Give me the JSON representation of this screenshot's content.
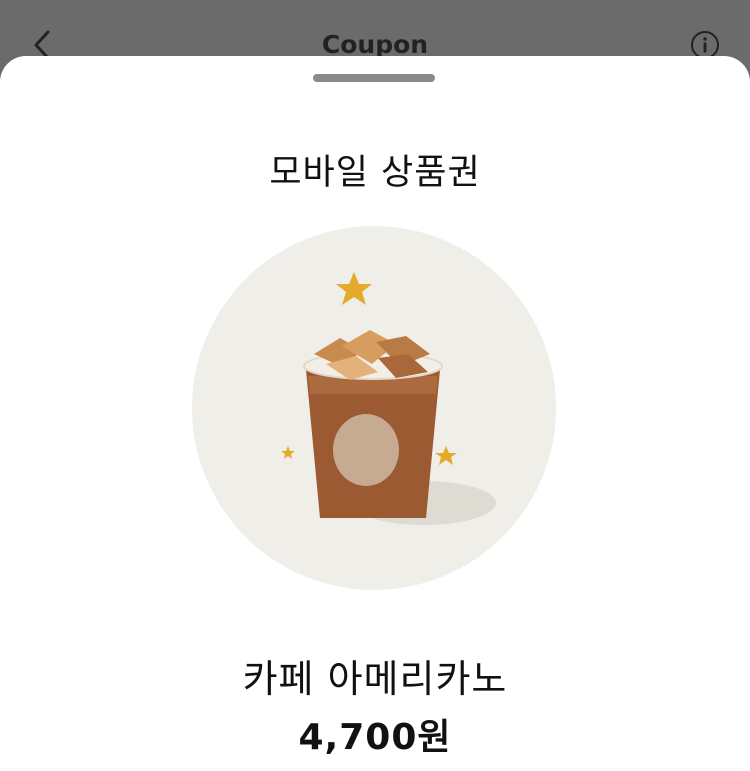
{
  "header": {
    "title": "Coupon",
    "back_icon": "chevron-left-icon",
    "info_icon": "info-icon"
  },
  "sheet": {
    "heading": "모바일 상품권",
    "product": {
      "name": "카페 아메리카노",
      "price": "4,700원",
      "image": "iced-americano-cup-illustration"
    }
  },
  "colors": {
    "overlay": "#6b6b6b",
    "sheet": "#ffffff",
    "circle": "#efeee9",
    "star": "#e5a92b",
    "coffee": "#9b5a32"
  }
}
